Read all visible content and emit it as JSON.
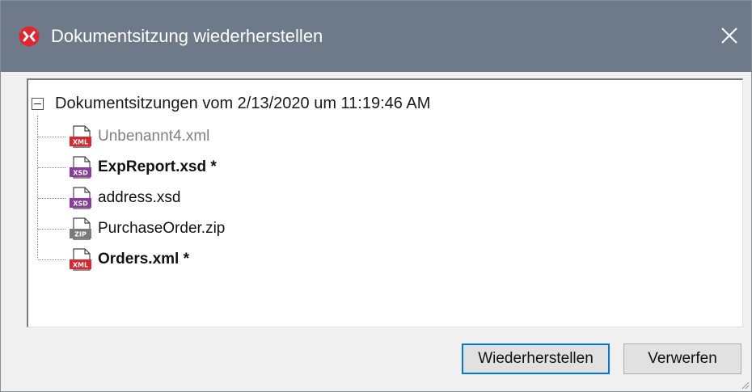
{
  "window": {
    "title": "Dokumentsitzung wiederherstellen",
    "accent": "#6e7a8a"
  },
  "tree": {
    "root_label": "Dokumentsitzungen vom 2/13/2020 um 11:19:46 AM",
    "items": [
      {
        "label": "Unbenannt4.xml",
        "type": "XML",
        "style": "muted",
        "icon": "xml-file-icon"
      },
      {
        "label": "ExpReport.xsd *",
        "type": "XSD",
        "style": "bold",
        "icon": "xsd-file-icon"
      },
      {
        "label": "address.xsd",
        "type": "XSD",
        "style": "normal",
        "icon": "xsd-file-icon"
      },
      {
        "label": "PurchaseOrder.zip",
        "type": "ZIP",
        "style": "normal",
        "icon": "zip-file-icon"
      },
      {
        "label": "Orders.xml *",
        "type": "XML",
        "style": "bold",
        "icon": "xml-file-icon"
      }
    ]
  },
  "buttons": {
    "restore": "Wiederherstellen",
    "discard": "Verwerfen"
  }
}
